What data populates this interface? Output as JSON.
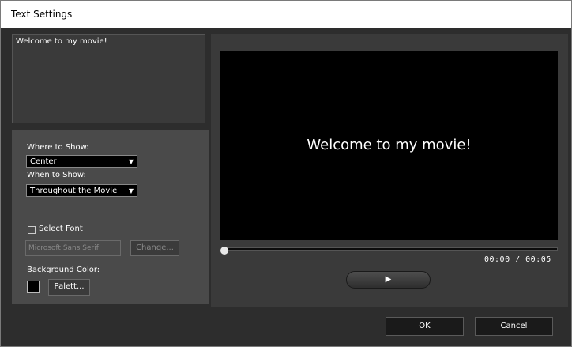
{
  "window": {
    "title": "Text Settings"
  },
  "text_input": {
    "value": "Welcome to my movie!"
  },
  "options": {
    "where_label": "Where to Show:",
    "where_value": "Center",
    "when_label": "When to Show:",
    "when_value": "Throughout the Movie",
    "select_font_label": "Select Font",
    "select_font_checked": false,
    "font_value": "Microsoft Sans Serif",
    "change_label": "Change...",
    "bg_color_label": "Background Color:",
    "bg_color": "#000000",
    "palette_label": "Palett..."
  },
  "preview": {
    "caption": "Welcome to my movie!",
    "time": "00:00  /  00:05",
    "progress": 0.0,
    "play_icon": "play-icon"
  },
  "buttons": {
    "ok": "OK",
    "cancel": "Cancel"
  }
}
